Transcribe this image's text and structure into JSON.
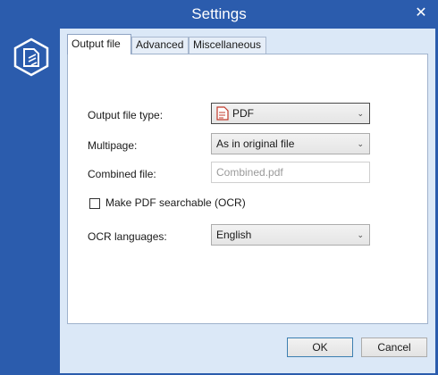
{
  "window": {
    "title": "Settings",
    "close_glyph": "✕"
  },
  "tabs": [
    {
      "label": "Output file",
      "active": true
    },
    {
      "label": "Advanced",
      "active": false
    },
    {
      "label": "Miscellaneous",
      "active": false
    }
  ],
  "form": {
    "output_file_type": {
      "label": "Output file type:",
      "value": "PDF",
      "icon": "pdf-file-icon"
    },
    "multipage": {
      "label": "Multipage:",
      "value": "As in original file"
    },
    "combined_file": {
      "label": "Combined file:",
      "value": "Combined.pdf"
    },
    "ocr_checkbox": {
      "label": "Make PDF searchable (OCR)",
      "checked": false
    },
    "ocr_languages": {
      "label": "OCR languages:",
      "value": "English"
    }
  },
  "buttons": {
    "ok": "OK",
    "cancel": "Cancel"
  },
  "colors": {
    "accent": "#2b5cad",
    "content_bg": "#dbe8f7",
    "pdf_red": "#c0392b"
  }
}
